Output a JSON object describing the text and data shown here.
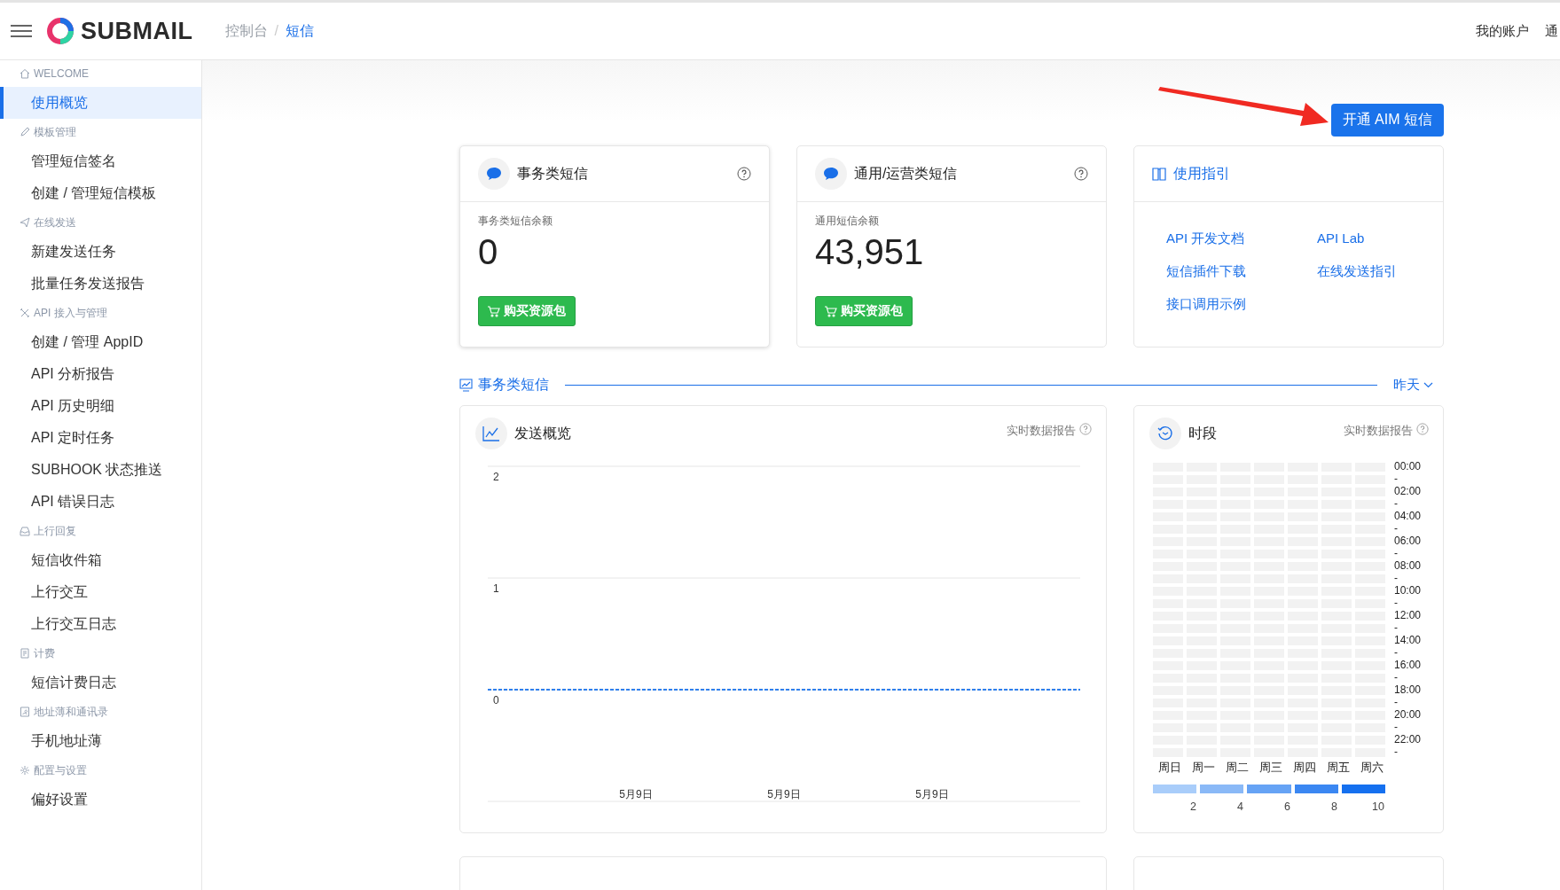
{
  "header": {
    "brand": "SUBMAIL",
    "breadcrumb": [
      {
        "label": "控制台",
        "current": false
      },
      {
        "label": "短信",
        "current": true
      }
    ],
    "breadcrumb_separator": "/",
    "nav": [
      "我的账户",
      "通"
    ]
  },
  "sidebar": [
    {
      "section": "WELCOME",
      "kind": "home",
      "items": [
        {
          "label": "使用概览",
          "selected": true
        }
      ]
    },
    {
      "section": "模板管理",
      "kind": "pencil",
      "items": [
        {
          "label": "管理短信签名",
          "selected": false
        },
        {
          "label": "创建 / 管理短信模板",
          "selected": false
        }
      ]
    },
    {
      "section": "在线发送",
      "kind": "plane",
      "items": [
        {
          "label": "新建发送任务",
          "selected": false
        },
        {
          "label": "批量任务发送报告",
          "selected": false
        }
      ]
    },
    {
      "section": "API 接入与管理",
      "kind": "tools",
      "items": [
        {
          "label": "创建 / 管理 AppID",
          "selected": false
        },
        {
          "label": "API 分析报告",
          "selected": false
        },
        {
          "label": "API 历史明细",
          "selected": false
        },
        {
          "label": "API 定时任务",
          "selected": false
        },
        {
          "label": "SUBHOOK 状态推送",
          "selected": false
        },
        {
          "label": "API 错误日志",
          "selected": false
        }
      ]
    },
    {
      "section": "上行回复",
      "kind": "inbox",
      "items": [
        {
          "label": "短信收件箱",
          "selected": false
        },
        {
          "label": "上行交互",
          "selected": false
        },
        {
          "label": "上行交互日志",
          "selected": false
        }
      ]
    },
    {
      "section": "计费",
      "kind": "receipt",
      "items": [
        {
          "label": "短信计费日志",
          "selected": false
        }
      ]
    },
    {
      "section": "地址薄和通讯录",
      "kind": "contact",
      "items": [
        {
          "label": "手机地址薄",
          "selected": false
        }
      ]
    },
    {
      "section": "配置与设置",
      "kind": "gear",
      "items": [
        {
          "label": "偏好设置",
          "selected": false
        }
      ]
    }
  ],
  "action_button": "开通 AIM 短信",
  "balance_cards": [
    {
      "title": "事务类短信",
      "label": "事务类短信余额",
      "value": "0",
      "button": "购买资源包"
    },
    {
      "title": "通用/运营类短信",
      "label": "通用短信余额",
      "value": "43,951",
      "button": "购买资源包"
    }
  ],
  "guide": {
    "title": "使用指引",
    "links": [
      "API 开发文档",
      "API Lab",
      "短信插件下载",
      "在线发送指引",
      "接口调用示例"
    ]
  },
  "section": {
    "title": "事务类短信",
    "range": "昨天"
  },
  "overview": {
    "title": "发送概览",
    "report": "实时数据报告",
    "chart_data": {
      "type": "line",
      "categories": [
        null,
        "5月9日",
        "5月9日",
        "5月9日",
        null
      ],
      "ylim": [
        -1,
        2
      ],
      "yticks": [
        {
          "value": 0,
          "label": "0"
        },
        {
          "value": 1,
          "label": "1"
        },
        {
          "value": 2,
          "label": "2"
        }
      ],
      "series": [
        {
          "color": "#2f80ed",
          "line_style": "dashed",
          "values": [
            0,
            0,
            0,
            0,
            0
          ]
        }
      ]
    }
  },
  "timeslot": {
    "title": "时段",
    "report": "实时数据报告",
    "days": [
      "周日",
      "周一",
      "周二",
      "周三",
      "周四",
      "周五",
      "周六"
    ],
    "times": [
      "00:00",
      "-",
      "02:00",
      "-",
      "04:00",
      "-",
      "06:00",
      "-",
      "08:00",
      "-",
      "10:00",
      "-",
      "12:00",
      "-",
      "14:00",
      "-",
      "16:00",
      "-",
      "18:00",
      "-",
      "20:00",
      "-",
      "22:00",
      "-"
    ],
    "legend": [
      {
        "color": "#a9cdfa",
        "label": "2"
      },
      {
        "color": "#8ab9f7",
        "label": "4"
      },
      {
        "color": "#66a3f5",
        "label": "6"
      },
      {
        "color": "#3b87f2",
        "label": "8"
      },
      {
        "color": "#1570ef",
        "label": "10"
      }
    ]
  }
}
